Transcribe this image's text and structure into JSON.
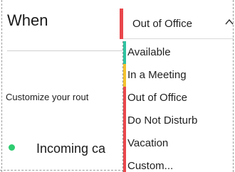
{
  "section": {
    "title": "When",
    "description_truncated": "Customize your rout",
    "row_label_truncated": "Incoming ca"
  },
  "status_select": {
    "selected": "Out of Office",
    "accent_color": "#e8474c",
    "chevron_icon": "chevron-up-icon"
  },
  "status_options": [
    {
      "label": "Available",
      "color": "#2fc2a0"
    },
    {
      "label": "In a Meeting",
      "color": "#f2c12e"
    },
    {
      "label": "Out of Office",
      "color": "#e8474c"
    },
    {
      "label": "Do Not Disturb",
      "color": "#e8474c"
    },
    {
      "label": "Vacation",
      "color": "#e8474c"
    },
    {
      "label": "Custom...",
      "color": "#e8474c"
    }
  ],
  "row_status_dot_color": "#2ecc71"
}
